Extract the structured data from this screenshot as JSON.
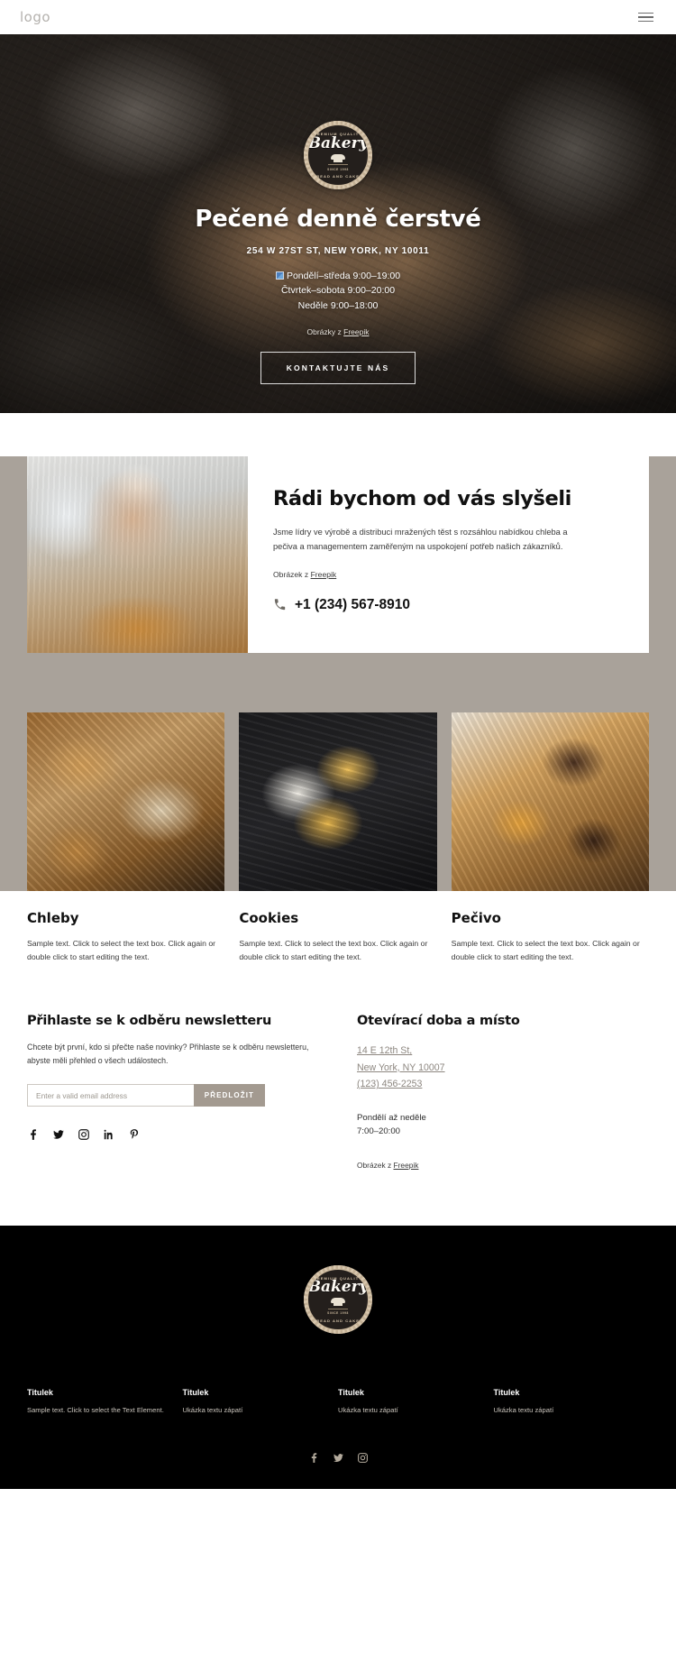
{
  "header": {
    "logo": "logo",
    "menu_icon": "hamburger-menu-icon"
  },
  "hero": {
    "badge": {
      "arc_top": "PREMIUM QUALITY",
      "word": "Bakery",
      "since": "SINCE 1998",
      "arc_bottom": "BREAD AND CAKES"
    },
    "title": "Pečené denně čerstvé",
    "address": "254 W 27ST ST, NEW YORK, NY 10011",
    "hours": [
      "Pondělí–středa 9:00–19:00",
      "Čtvrtek–sobota 9:00–20:00",
      "Neděle 9:00–18:00"
    ],
    "credit_prefix": "Obrázky z ",
    "credit_link": "Freepik",
    "cta_label": "KONTAKTUJTE NÁS"
  },
  "about": {
    "title": "Rádi bychom od vás slyšeli",
    "paragraph": "Jsme lídry ve výrobě a distribuci mražených těst s rozsáhlou nabídkou chleba a pečiva a managementem zaměřeným na uspokojení potřeb našich zákazníků.",
    "credit_prefix": "Obrázek z ",
    "credit_link": "Freepik",
    "phone": "+1 (234) 567-8910",
    "phone_icon": "phone-icon"
  },
  "gallery": [
    {
      "title": "Chleby",
      "text": "Sample text. Click to select the text box. Click again or double click to start editing the text."
    },
    {
      "title": "Cookies",
      "text": "Sample text. Click to select the text box. Click again or double click to start editing the text."
    },
    {
      "title": "Pečivo",
      "text": "Sample text. Click to select the text box. Click again or double click to start editing the text."
    }
  ],
  "newsletter": {
    "title": "Přihlaste se k odběru newsletteru",
    "paragraph": "Chcete být první, kdo si přečte naše novinky? Přihlaste se k odběru newsletteru, abyste měli přehled o všech událostech.",
    "input_placeholder": "Enter a valid email address",
    "input_value": "",
    "submit_label": "PŘEDLOŽIT",
    "socials": [
      "facebook-icon",
      "twitter-icon",
      "instagram-icon",
      "linkedin-icon",
      "pinterest-icon"
    ]
  },
  "location": {
    "title": "Otevírací doba a místo",
    "address_line1": "14 E 12th St,",
    "address_line2": "New York, NY 10007",
    "phone": "(123) 456-2253",
    "hours_days": "Pondělí až neděle",
    "hours_time": "7:00–20:00",
    "credit_prefix": "Obrázek z ",
    "credit_link": "Freepik"
  },
  "footer": {
    "badge": {
      "arc_top": "PREMIUM QUALITY",
      "word": "Bakery",
      "since": "SINCE 1998",
      "arc_bottom": "BREAD AND CAKES"
    },
    "columns": [
      {
        "title": "Titulek",
        "text": "Sample text. Click to select the Text Element."
      },
      {
        "title": "Titulek",
        "text": "Ukázka textu zápatí"
      },
      {
        "title": "Titulek",
        "text": "Ukázka textu zápatí"
      },
      {
        "title": "Titulek",
        "text": "Ukázka textu zápatí"
      }
    ],
    "socials": [
      "facebook-icon",
      "twitter-icon",
      "instagram-icon"
    ]
  },
  "colors": {
    "taupe_background": "#a9a29a",
    "footer_background": "#000000",
    "submit_button": "#a39a90",
    "badge_ring": "#d8c7ae",
    "link_muted": "#8d8780"
  }
}
